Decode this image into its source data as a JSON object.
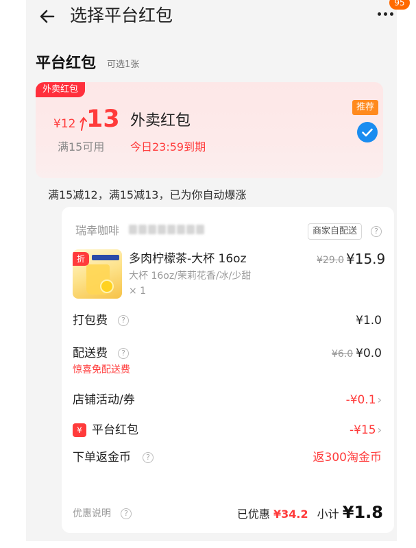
{
  "header": {
    "title": "选择平台红包",
    "badge_count": "95"
  },
  "section": {
    "title": "平台红包",
    "subtitle": "可选1张"
  },
  "coupon": {
    "tag": "外卖红包",
    "old_amount": "¥12",
    "new_amount": "13",
    "name": "外卖红包",
    "condition": "满15可用",
    "expire": "今日23:59到期",
    "recommend": "推荐",
    "selected": true,
    "accent_color": "#ff3b3b"
  },
  "boost_text": "满15减12，满15减13，已为你自动爆涨",
  "order": {
    "shop_name": "瑞幸咖啡",
    "delivery_tag": "商家自配送",
    "item": {
      "thumb_tag": "折",
      "name": "多肉柠檬茶-大杯 16oz",
      "spec": "大杯 16oz/茉莉花香/冰/少甜",
      "qty": "× 1",
      "old_price": "¥29.0",
      "price": "¥15.9"
    },
    "packing": {
      "label": "打包费",
      "value": "¥1.0"
    },
    "delivery": {
      "label": "配送费",
      "old_value": "¥6.0",
      "value": "¥0.0",
      "note": "惊喜免配送费"
    },
    "store_promo": {
      "label": "店铺活动/券",
      "value": "-¥0.1"
    },
    "platform": {
      "icon": "¥",
      "label": "平台红包",
      "value": "-¥15"
    },
    "coins": {
      "label": "下单返金币",
      "value": "返300淘金币"
    },
    "footer": {
      "note": "优惠说明",
      "saved_label": "已优惠",
      "saved_value": "¥34.2",
      "subtotal_label": "小计",
      "subtotal_value": "¥1.8"
    }
  }
}
